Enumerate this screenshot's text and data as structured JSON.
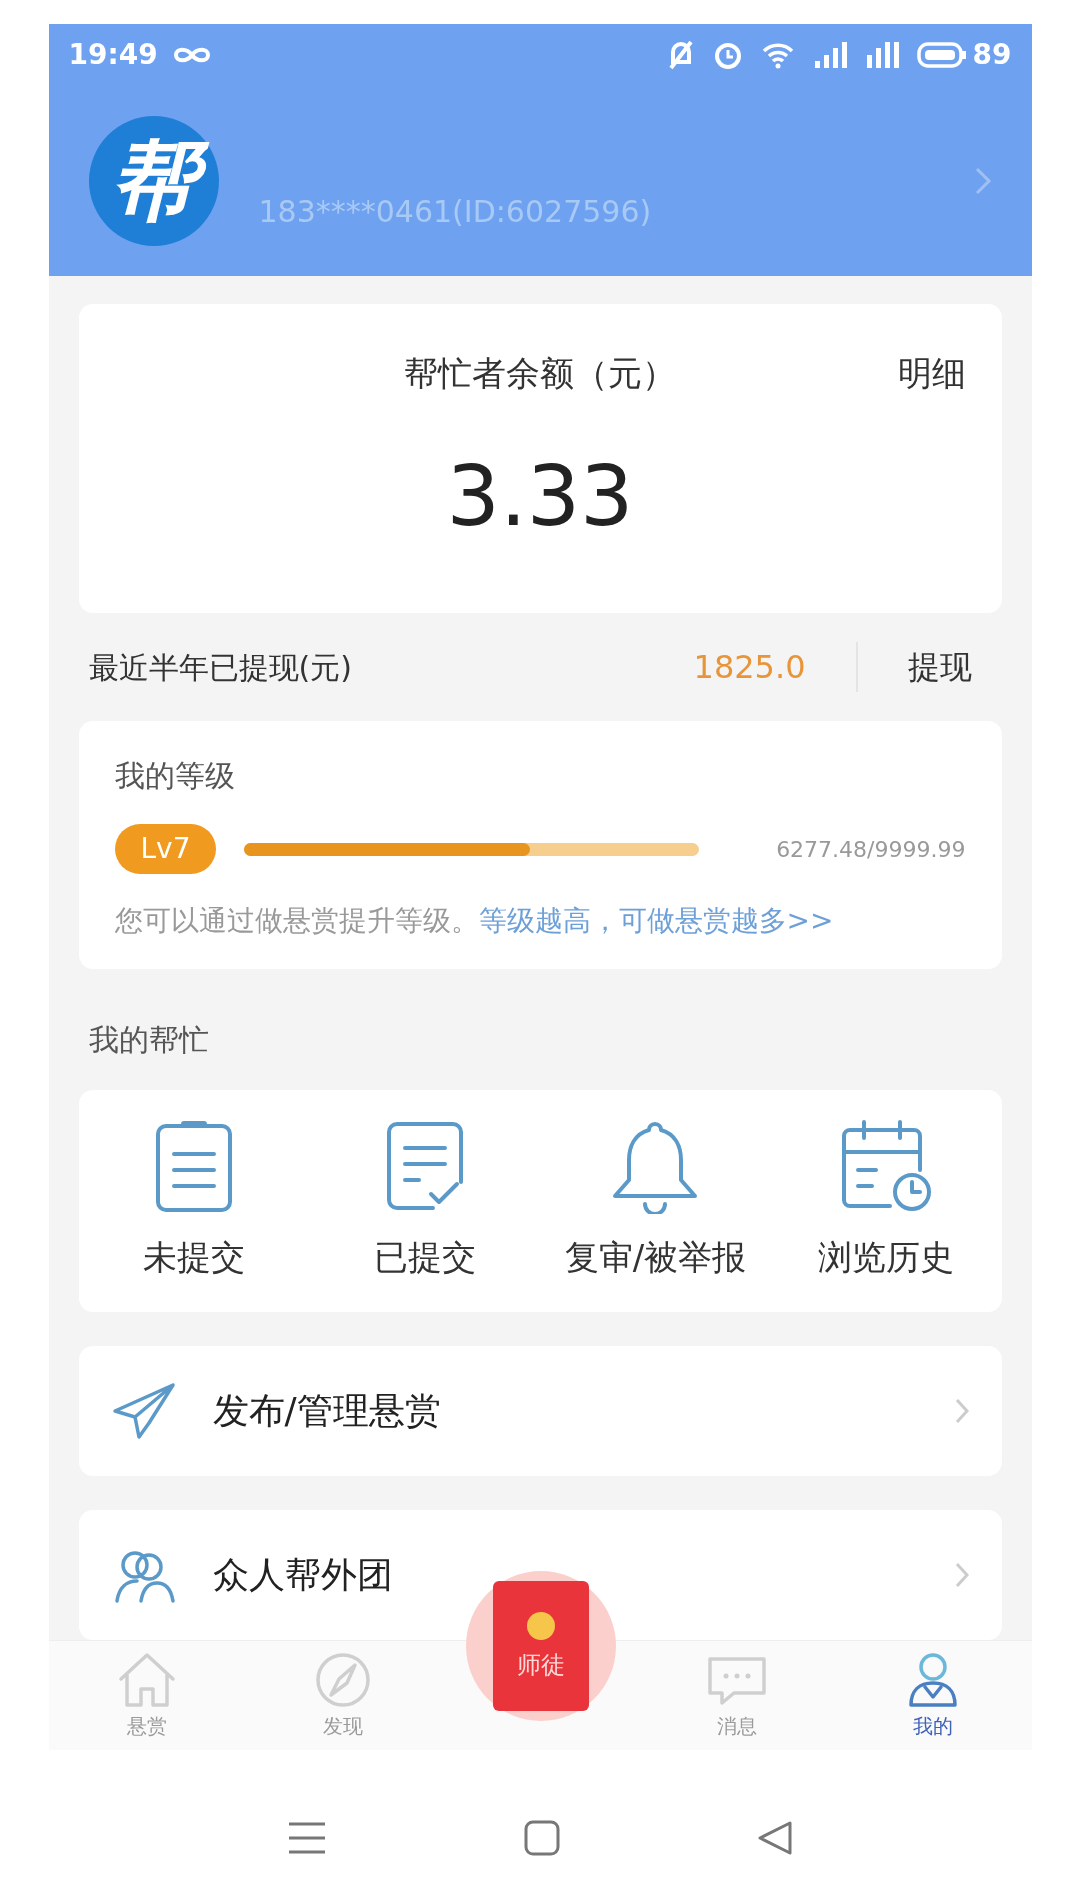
{
  "status_bar": {
    "time": "19:49",
    "battery": "89"
  },
  "profile": {
    "logo_char": "帮",
    "account": "183****0461(ID:6027596)"
  },
  "balance": {
    "label": "帮忙者余额（元）",
    "amount": "3.33",
    "detail_link": "明细"
  },
  "withdrawn": {
    "label": "最近半年已提现(元)",
    "amount": "1825.0",
    "action": "提现"
  },
  "level_card": {
    "title": "我的等级",
    "badge": "Lv7",
    "level": 0.6277,
    "reading": "6277.48/9999.99",
    "note": "您可以通过做悬赏提升等级。",
    "link": "等级越高，可做悬赏越多>>"
  },
  "my_help": {
    "title": "我的帮忙",
    "items": [
      {
        "label": "未提交",
        "kind": "clipboard"
      },
      {
        "label": "已提交",
        "kind": "checked-doc"
      },
      {
        "label": "复审/被举报",
        "kind": "bell"
      },
      {
        "label": "浏览历史",
        "kind": "calendar"
      }
    ]
  },
  "menu": [
    {
      "label": "发布/管理悬赏",
      "kind": "send"
    },
    {
      "label": "众人帮外团",
      "kind": "people"
    }
  ],
  "bottom_nav": {
    "center_badge": "师徒",
    "items": [
      {
        "label": "悬赏",
        "kind": "home",
        "selected": false
      },
      {
        "label": "发现",
        "kind": "compass",
        "selected": false
      },
      {
        "label": "消息",
        "kind": "chat",
        "selected": false
      },
      {
        "label": "我的",
        "kind": "person",
        "selected": true
      }
    ]
  }
}
